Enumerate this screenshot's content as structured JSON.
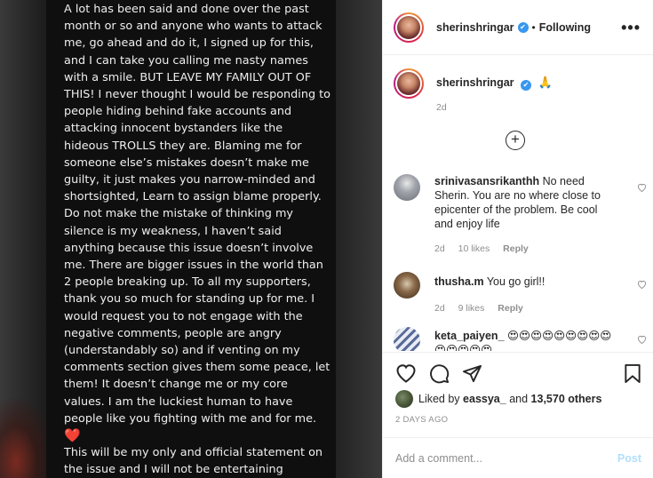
{
  "post_image": {
    "paragraph1": "A lot has been said and done over the past month or so and anyone who wants to attack me, go ahead and do it, I signed up for this, and I can take you calling me nasty names with a smile. BUT LEAVE MY FAMILY OUT OF THIS! I never thought I would be responding to people hiding behind fake accounts and attacking innocent bystanders like the hideous TROLLS they are. Blaming me for someone else’s mistakes doesn’t make me guilty, it just makes you narrow-minded and shortsighted, Learn to assign blame properly. Do not make the mistake of thinking my silence is my weakness, I haven’t said anything because this issue doesn’t involve me. There are bigger issues in the world than 2 people breaking up. To all my supporters, thank you so much for standing up for me. I would request you to not engage with the negative comments, people are angry (understandably so) and if venting on my comments section gives them some peace, let them! It doesn’t change me or my core values. I am the luckiest human to have people like you fighting with me and for me.",
    "heart": "❤️",
    "paragraph2": "This will be my only and official statement on the issue and I will not be entertaining questions and reactions on the same again!"
  },
  "header": {
    "username": "sherinshringar",
    "verified_mark": "✔",
    "separator": "•",
    "follow_state": "Following",
    "more": "•••"
  },
  "caption": {
    "username": "sherinshringar",
    "emoji": "🙏",
    "time": "2d"
  },
  "load_more": "+",
  "comments": [
    {
      "username": "srinivasansrikanthh",
      "text": "No need Sherin. You are no where close to epicenter of the problem. Be cool and enjoy life",
      "time": "2d",
      "likes": "10 likes",
      "reply": "Reply",
      "avatar_color": "#8a8f96"
    },
    {
      "username": "thusha.m",
      "text": "You go girl!!",
      "time": "2d",
      "likes": "9 likes",
      "reply": "Reply",
      "avatar_color": "#5a4a3a"
    },
    {
      "username": "keta_paiyen_",
      "text": "😍😍😍😍😍😍😍😍😍😍😍😍😍😍",
      "avatar_color": "#6a7aa0"
    }
  ],
  "likes": {
    "prefix": "Liked by",
    "user": "eassya_",
    "and": "and",
    "count": "13,570 others"
  },
  "post_time": "2 DAYS AGO",
  "add_comment": {
    "placeholder": "Add a comment...",
    "post_label": "Post"
  },
  "colors": {
    "accent": "#3897f0",
    "post_disabled": "#b2dffc",
    "muted": "#8e8e8e"
  }
}
